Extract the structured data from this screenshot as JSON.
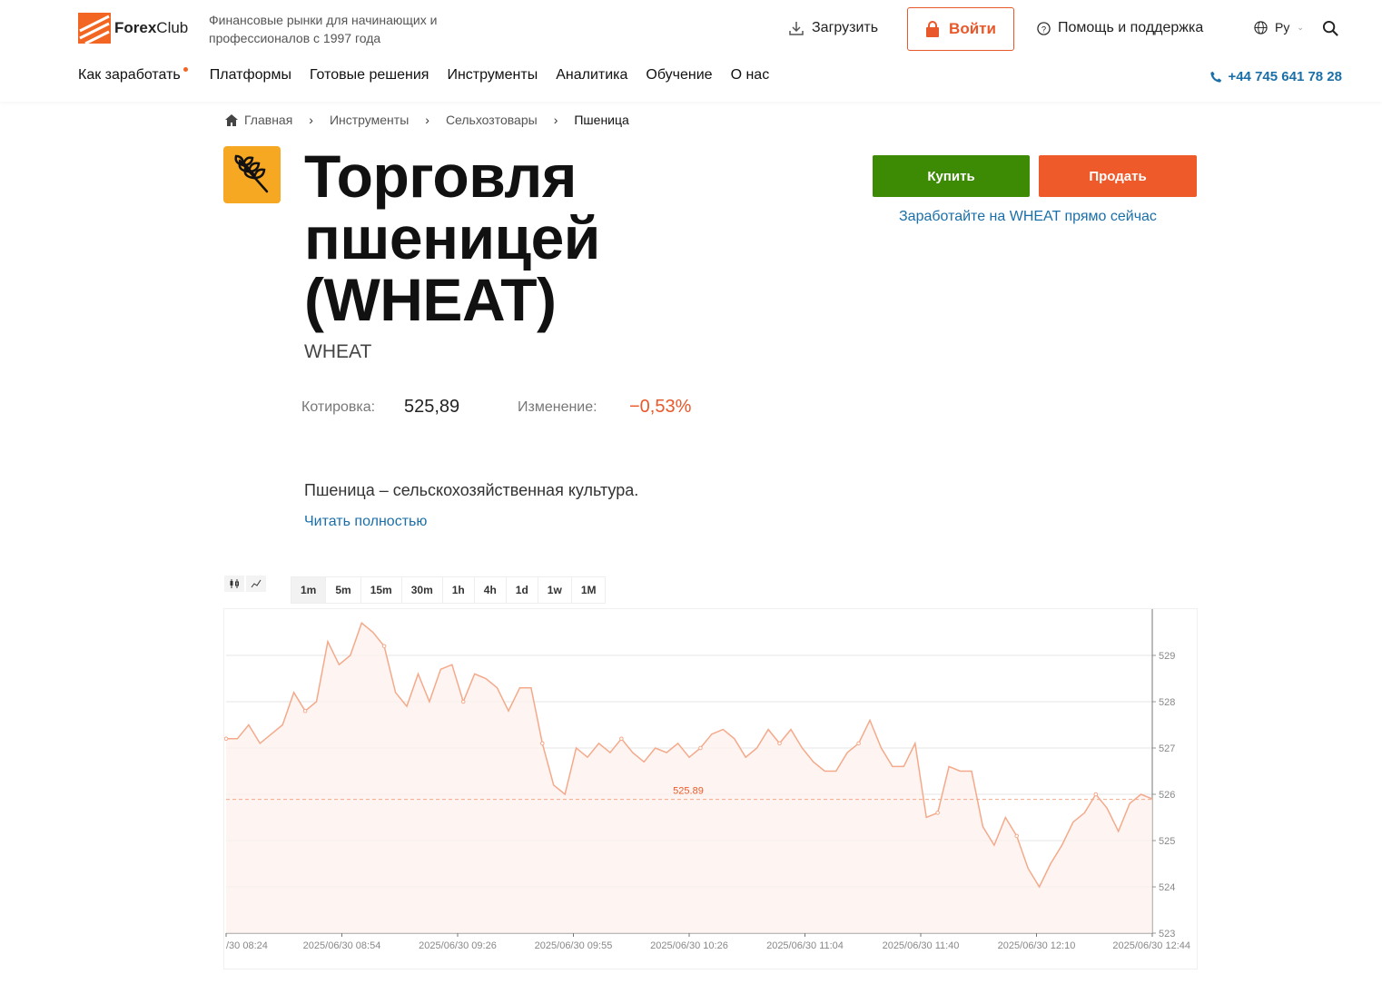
{
  "header": {
    "logo_brand": "Forex",
    "logo_brand_light": "Club",
    "tagline": "Финансовые рынки для начинающих и профессионалов с 1997 года",
    "download_label": "Загрузить",
    "login_label": "Войти",
    "help_label": "Помощь и поддержка",
    "lang_label": "Ру",
    "phone": "+44 745 641 78 28",
    "nav": [
      "Как заработать",
      "Платформы",
      "Готовые решения",
      "Инструменты",
      "Аналитика",
      "Обучение",
      "О нас"
    ]
  },
  "breadcrumb": [
    "Главная",
    "Инструменты",
    "Сельхозтовары",
    "Пшеница"
  ],
  "asset": {
    "title": "Торговля пшеницей (WHEAT)",
    "ticker": "WHEAT",
    "quote_label": "Котировка:",
    "quote_value": "525,89",
    "change_label": "Изменение:",
    "change_value": "−0,53%",
    "buy_label": "Купить",
    "sell_label": "Продать",
    "earn_link": "Заработайте на WHEAT прямо сейчас",
    "description": "Пшеница – сельскохозяйственная культура.",
    "read_more": "Читать полностью"
  },
  "chart_controls": {
    "timeframes": [
      "1m",
      "5m",
      "15m",
      "30m",
      "1h",
      "4h",
      "1d",
      "1w",
      "1M"
    ],
    "active_timeframe": "1m"
  },
  "colors": {
    "accent": "#ef5a2a",
    "buy": "#3d8a05",
    "link": "#1b6fa8",
    "line": "#f4a98a"
  },
  "chart_data": {
    "type": "area",
    "current_price": 525.89,
    "current_label": "525.89",
    "ylim": [
      523,
      530
    ],
    "yticks": [
      523,
      524,
      525,
      526,
      527,
      528,
      529
    ],
    "xticks": [
      "/30 08:24",
      "2025/06/30 08:54",
      "2025/06/30 09:26",
      "2025/06/30 09:55",
      "2025/06/30 10:26",
      "2025/06/30 11:04",
      "2025/06/30 11:40",
      "2025/06/30 12:10",
      "2025/06/30 12:44"
    ],
    "values": [
      527.2,
      527.2,
      527.5,
      527.1,
      527.3,
      527.5,
      528.2,
      527.8,
      528.0,
      529.3,
      528.8,
      529.0,
      529.7,
      529.5,
      529.2,
      528.2,
      527.9,
      528.6,
      528.0,
      528.7,
      528.8,
      528.0,
      528.6,
      528.5,
      528.3,
      527.8,
      528.3,
      528.3,
      527.1,
      526.2,
      526.0,
      527.0,
      526.8,
      527.1,
      526.9,
      527.2,
      526.9,
      526.7,
      527.0,
      526.9,
      527.1,
      526.8,
      527.0,
      527.3,
      527.4,
      527.2,
      526.8,
      527.0,
      527.4,
      527.1,
      527.4,
      527.0,
      526.7,
      526.5,
      526.5,
      526.9,
      527.1,
      527.6,
      527.0,
      526.6,
      526.6,
      527.1,
      525.5,
      525.6,
      526.6,
      526.5,
      526.5,
      525.3,
      524.9,
      525.5,
      525.1,
      524.4,
      524.0,
      524.5,
      524.9,
      525.4,
      525.6,
      526.0,
      525.7,
      525.2,
      525.8,
      526.0,
      525.9
    ]
  }
}
